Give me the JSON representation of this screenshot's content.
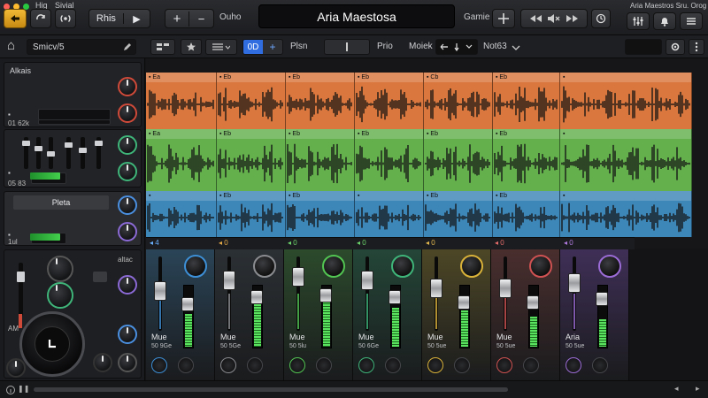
{
  "window": {
    "menu": [
      "Hig",
      "Sivial"
    ],
    "title": "Aria Maestosa",
    "right_text": "Aria Maestros Sru. Orog"
  },
  "toolbar": {
    "record_label": "Rhis",
    "play_glyph": "▶",
    "add_glyph": "+",
    "minus_glyph": "−",
    "mode_label": "Ouho",
    "game_label": "Gamie",
    "icons": [
      "back-arrow-icon",
      "loop-icon",
      "broadcast-icon",
      "play-icon",
      "plus-icon",
      "minus-icon",
      "move-icon",
      "rewind-icon",
      "mute-icon",
      "forward-icon",
      "clock-icon",
      "mixer-icon",
      "bell-icon",
      "list-icon"
    ]
  },
  "subbar": {
    "home_glyph": "⌂",
    "location": "Smicv/5",
    "view_tab": "0D",
    "plus_glyph": "+",
    "label_1": "Plsn",
    "label_2": "Prio",
    "label_3": "Moiek",
    "label_4": "Not63",
    "accent": "#2f6de0"
  },
  "left_panel": {
    "header": "Alkais",
    "row1_label": "01 62k",
    "row2_label": "05 83",
    "section_label": "Pleta",
    "row3_label": "1ul",
    "row4_label": "AM",
    "row5_label": "altac",
    "meter_levels": [
      0.55,
      0.7
    ]
  },
  "tracks": [
    {
      "color": "#d9773e",
      "clips": [
        {
          "label": "Ea"
        },
        {
          "label": "Eb"
        },
        {
          "label": "Eb"
        },
        {
          "label": "Eb"
        },
        {
          "label": "Cb"
        },
        {
          "label": "Eb"
        },
        {
          "label": ""
        }
      ]
    },
    {
      "color": "#63b04c",
      "clips": [
        {
          "label": "Ea"
        },
        {
          "label": "Eb"
        },
        {
          "label": "Eb"
        },
        {
          "label": "Eb"
        },
        {
          "label": "Eb"
        },
        {
          "label": "Eb"
        },
        {
          "label": ""
        }
      ]
    },
    {
      "color": "#3d86b8",
      "clips": [
        {
          "label": ""
        },
        {
          "label": "Eb"
        },
        {
          "label": "Eb"
        },
        {
          "label": ""
        },
        {
          "label": "Eb"
        },
        {
          "label": "Eb"
        },
        {
          "label": ""
        }
      ]
    }
  ],
  "strip_header": [
    {
      "label": "◂ 4",
      "color": "#6ab0ff"
    },
    {
      "label": "◂ 0",
      "color": "#e2a847"
    },
    {
      "label": "◂ 0",
      "color": "#6bd36b"
    },
    {
      "label": "◂ 0",
      "color": "#6bd36b"
    },
    {
      "label": "◂ 0",
      "color": "#e3b84f"
    },
    {
      "label": "◂ 0",
      "color": "#e36b6b"
    },
    {
      "label": "◂ 0",
      "color": "#b07ae0"
    }
  ],
  "channels": [
    {
      "name": "Mue",
      "sub": "50 9Ge",
      "color": "#2a4457",
      "accent": "#3d8fd6",
      "level": 0.55,
      "fader": 0.55
    },
    {
      "name": "Mue",
      "sub": "50 5Ge",
      "color": "#2b3034",
      "accent": "#8a8c90",
      "level": 0.7,
      "fader": 0.75
    },
    {
      "name": "Mue",
      "sub": "50 5lu",
      "color": "#2c4a2c",
      "accent": "#52c552",
      "level": 0.75,
      "fader": 0.8
    },
    {
      "name": "Mue",
      "sub": "50 6Ge",
      "color": "#244638",
      "accent": "#3fb57a",
      "level": 0.65,
      "fader": 0.75
    },
    {
      "name": "Mue",
      "sub": "50 5ue",
      "color": "#4d4726",
      "accent": "#d9b23a",
      "level": 0.6,
      "fader": 0.6
    },
    {
      "name": "Mue",
      "sub": "50 5ue",
      "color": "#4a2e2e",
      "accent": "#d05252",
      "level": 0.5,
      "fader": 0.6
    },
    {
      "name": "Aria",
      "sub": "50 5ue",
      "color": "#3f2f57",
      "accent": "#9b6cd6",
      "level": 0.45,
      "fader": 0.7
    }
  ]
}
